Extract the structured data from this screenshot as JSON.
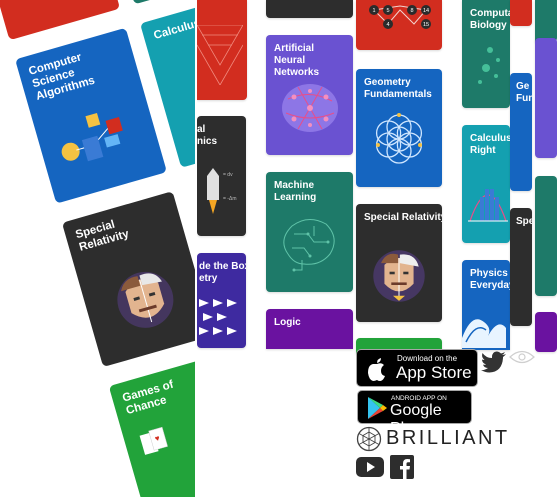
{
  "cards": {
    "artificial_neural_networks": "Artificial Neural Networks",
    "geometry_fundamentals": "Geometry Fundamentals",
    "machine_learning": "Machine Learning",
    "special_relativity": "Special Relativity",
    "logic": "Logic",
    "computational_biology": "Computational Biology",
    "calculus_done_right": "Calculus Done Right",
    "physics_of_everyday": "Physics of the Everyday",
    "geometry_fu_partial": "Geometry Fundamentals",
    "special_partial": "Special Relativity",
    "calc_partial": "Calculus Done Right",
    "outside_box_partial": "Outside the Box Geometry",
    "rockets_partial": "Classical Mechanics"
  },
  "tilted_cards": {
    "cs_algorithms": "Computer Science Algorithms",
    "special_relativity": "Special Relativity",
    "games_of_chance": "Games of Chance",
    "calculus": "Calculus"
  },
  "app_store": {
    "small": "Download on the",
    "big": "App Store"
  },
  "google_play": {
    "small": "ANDROID APP ON",
    "big": "Google Play"
  },
  "brand": "BRILLIANT",
  "colors": {
    "red": "#d22d1f",
    "teal": "#1e7a69",
    "blue": "#1565c0",
    "purple": "#6a52d1",
    "dark": "#2d2d2d",
    "indigo": "#3e2aa0",
    "green": "#22a33a",
    "violet": "#6a12a0"
  },
  "icons": [
    "apple-icon",
    "play-icon",
    "twitter-icon",
    "eye-icon",
    "brilliant-logo-icon",
    "youtube-icon",
    "facebook-icon"
  ],
  "tilted_numbers": [
    "2",
    "3",
    "12",
    "1",
    "5",
    "8",
    "14",
    "4",
    "15"
  ],
  "card_numbers": [
    "1",
    "5",
    "8",
    "14",
    "4",
    "15"
  ]
}
